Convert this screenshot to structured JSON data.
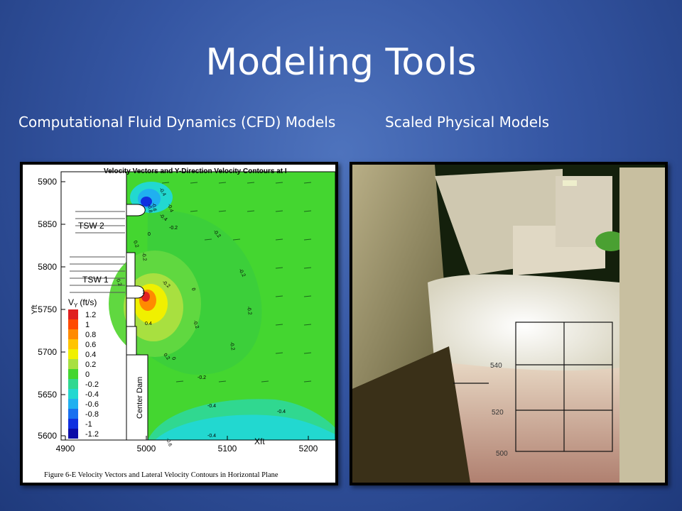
{
  "slide": {
    "title": "Modeling Tools",
    "left_heading": "Computational Fluid Dynamics (CFD) Models",
    "right_heading": "Scaled Physical Models"
  },
  "cfd_figure": {
    "plot_title": "Velocity Vectors and Y-Direction Velocity Contours at I",
    "caption": "Figure 6-E Velocity Vectors and Lateral Velocity Contours in Horizontal Plane",
    "x_label": "Xft",
    "y_label": "Yft",
    "x_ticks": [
      "4900",
      "5000",
      "5100",
      "5200"
    ],
    "y_ticks": [
      "5900",
      "5850",
      "5800",
      "5750",
      "5700",
      "5650",
      "5600"
    ],
    "legend_title": "V",
    "legend_subscript": "Y",
    "legend_units": "(ft/s)",
    "legend_values": [
      "1.2",
      "1",
      "0.8",
      "0.6",
      "0.4",
      "0.2",
      "0",
      "-0.2",
      "-0.4",
      "-0.6",
      "-0.8",
      "-1",
      "-1.2"
    ],
    "legend_colors": [
      "#e02020",
      "#ff4a00",
      "#ff8a00",
      "#ffc400",
      "#f0f000",
      "#a8e040",
      "#44d630",
      "#30d890",
      "#22d8d0",
      "#20b0f0",
      "#1870f0",
      "#1030e0",
      "#0c0ca8"
    ],
    "label_tsw2": "TSW 2",
    "label_tsw1": "TSW 1",
    "label_dam": "Center Dam",
    "contour_labels": [
      "-0.4",
      "-0.6",
      "-0.8",
      "-0.4",
      "-0.4",
      "-0.2",
      "-0.2",
      "0",
      "0.2",
      "-0.2",
      "-0.2",
      "0.2",
      "-0.2",
      "1",
      "-0.2",
      "0",
      "0.4",
      "-0.2",
      "-0.2",
      "0",
      "0.2",
      "-0.2",
      "-0.4",
      "-0.4",
      "-0.6",
      "-0.4"
    ]
  },
  "photo": {
    "grid_numbers": [
      "540",
      "520",
      "500"
    ]
  },
  "colors": {
    "background": "#3556a3",
    "cfd_green": "#44d630"
  }
}
